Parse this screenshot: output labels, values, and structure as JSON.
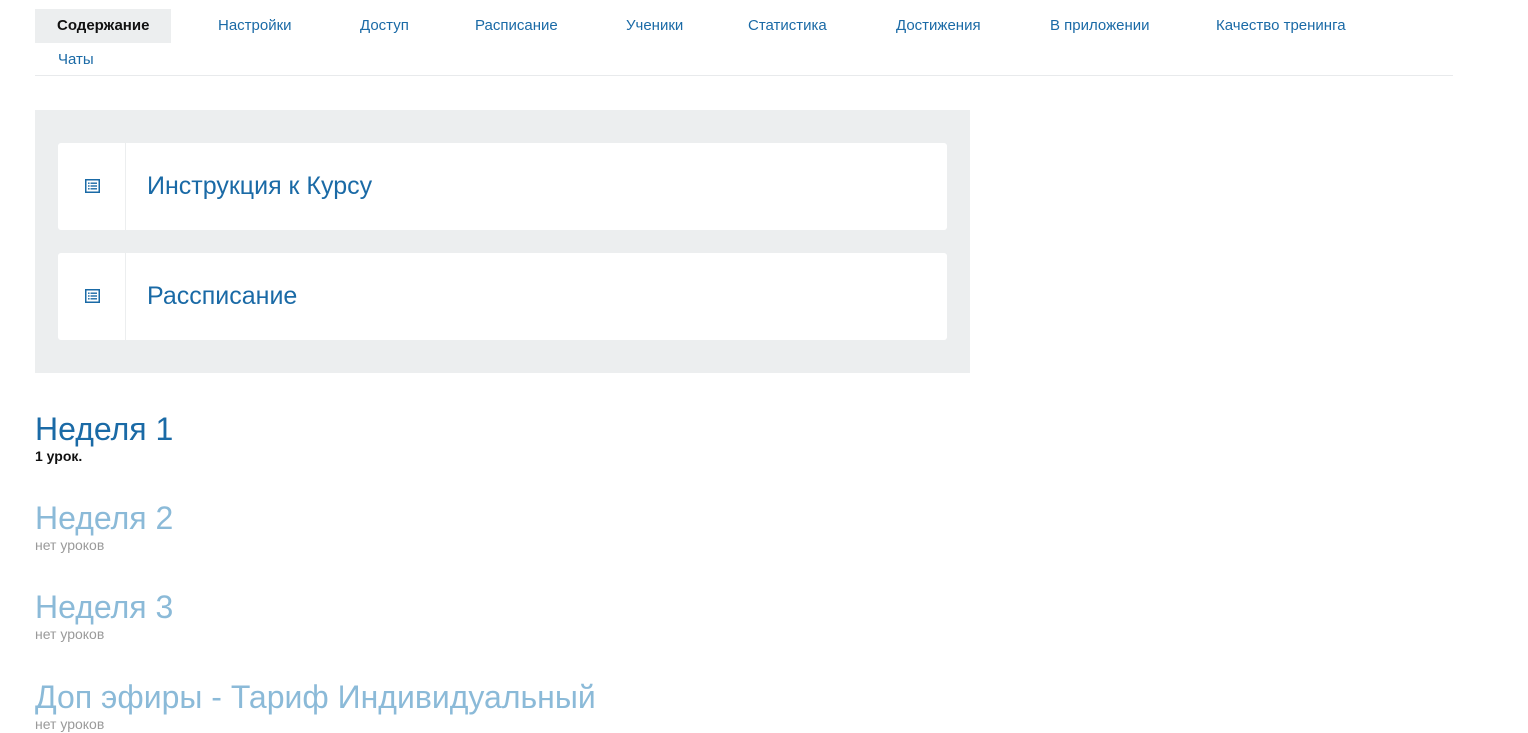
{
  "tabs": [
    {
      "label": "Содержание",
      "active": true
    },
    {
      "label": "Настройки"
    },
    {
      "label": "Доступ"
    },
    {
      "label": "Расписание"
    },
    {
      "label": "Ученики"
    },
    {
      "label": "Статистика"
    },
    {
      "label": "Достижения"
    },
    {
      "label": "В приложении"
    },
    {
      "label": "Качество тренинга"
    },
    {
      "label": "Чаты"
    }
  ],
  "cards": [
    {
      "title": "Инструкция к Курсу",
      "icon": "list-icon"
    },
    {
      "title": "Рассписание",
      "icon": "list-icon"
    }
  ],
  "sections": [
    {
      "title": "Неделя 1",
      "subtitle": "1 урок."
    },
    {
      "title": "Неделя 2",
      "subtitle": "нет уроков"
    },
    {
      "title": "Неделя 3",
      "subtitle": "нет уроков"
    },
    {
      "title": "Доп эфиры - Тариф Индивидуальный",
      "subtitle": "нет уроков"
    }
  ],
  "colors": {
    "accent": "#1a6aa6",
    "muted_title": "#8bbad8",
    "panel_bg": "#eceeef"
  }
}
